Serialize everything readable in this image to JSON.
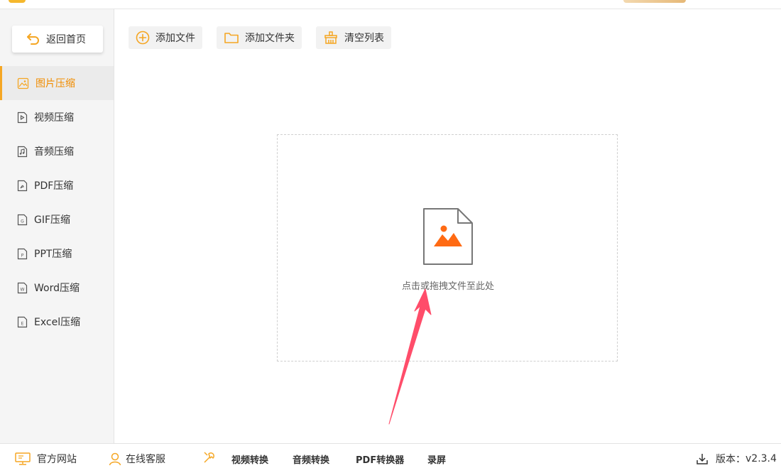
{
  "colors": {
    "accent": "#f5a623",
    "accent_text": "#f08c00",
    "arrow": "#ff4d6a",
    "image_icon": "#ff6a13"
  },
  "sidebar": {
    "back_label": "返回首页",
    "items": [
      {
        "label": "图片压缩",
        "icon": "image-file-icon",
        "active": true
      },
      {
        "label": "视频压缩",
        "icon": "video-file-icon"
      },
      {
        "label": "音频压缩",
        "icon": "audio-file-icon"
      },
      {
        "label": "PDF压缩",
        "icon": "pdf-file-icon"
      },
      {
        "label": "GIF压缩",
        "icon": "gif-file-icon"
      },
      {
        "label": "PPT压缩",
        "icon": "ppt-file-icon"
      },
      {
        "label": "Word压缩",
        "icon": "word-file-icon"
      },
      {
        "label": "Excel压缩",
        "icon": "excel-file-icon"
      }
    ]
  },
  "toolbar": {
    "add_file": "添加文件",
    "add_folder": "添加文件夹",
    "clear_list": "清空列表"
  },
  "dropzone": {
    "hint": "点击或拖拽文件至此处"
  },
  "footer": {
    "website": "官方网站",
    "support": "在线客服",
    "video_convert": "视频转换",
    "audio_convert": "音频转换",
    "pdf_converter": "PDF转换器",
    "screen_record": "录屏",
    "version_label": "版本：",
    "version_value": "v2.3.4"
  }
}
